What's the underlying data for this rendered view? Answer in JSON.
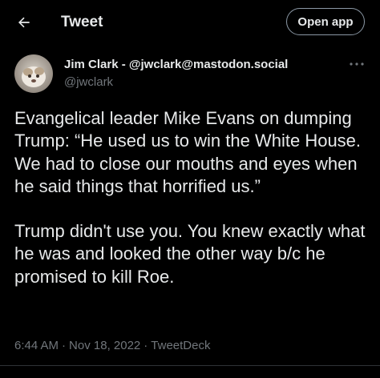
{
  "header": {
    "title": "Tweet",
    "open_app_label": "Open app",
    "back_icon": "arrow-left-icon"
  },
  "tweet": {
    "author_name": "Jim Clark - @jwclark@mastodon.social",
    "author_handle": "@jwclark",
    "more_icon": "more-horizontal-icon",
    "paragraph_1": "Evangelical leader Mike Evans on dumping Trump: “He used us to win the White House. We had to close our mouths and eyes when he said things that horrified us.”",
    "paragraph_2": "Trump didn't use you. You knew exactly what he was and looked the other way b/c he promised to kill Roe.",
    "time": "6:44 AM",
    "date": "Nov 18, 2022",
    "source": "TweetDeck",
    "separator": "·"
  },
  "colors": {
    "background": "#000000",
    "text_primary": "#e7e9ea",
    "text_secondary": "#71767b",
    "border": "#2f3336"
  }
}
